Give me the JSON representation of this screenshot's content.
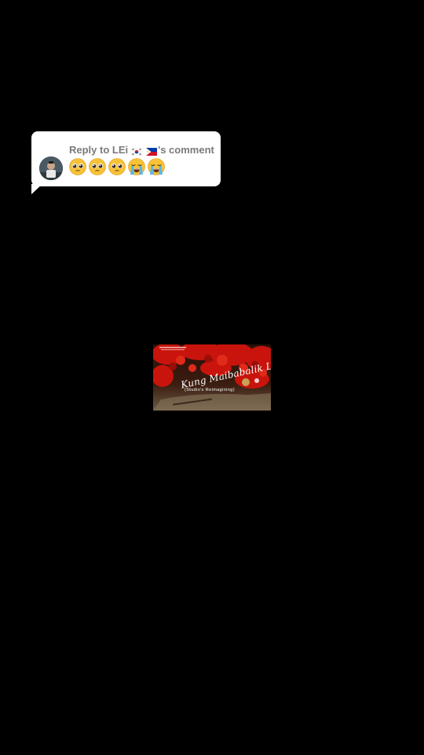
{
  "reply_bubble": {
    "prefix": "Reply to LEi",
    "suffix": "'s comment",
    "flags": [
      "south-korea-flag-icon",
      "philippines-flag-icon"
    ],
    "emojis": [
      "pleading-face-emoji",
      "pleading-face-emoji",
      "pleading-face-emoji",
      "loudly-crying-face-emoji",
      "loudly-crying-face-emoji"
    ]
  },
  "video": {
    "title": "Kung Maibabalik Lang",
    "subtitle": "(Studio's Reimagining)"
  },
  "colors": {
    "background": "#000000",
    "bubble": "#ffffff",
    "reply_text": "#7a7a7a",
    "leaves": "#c8140c"
  }
}
